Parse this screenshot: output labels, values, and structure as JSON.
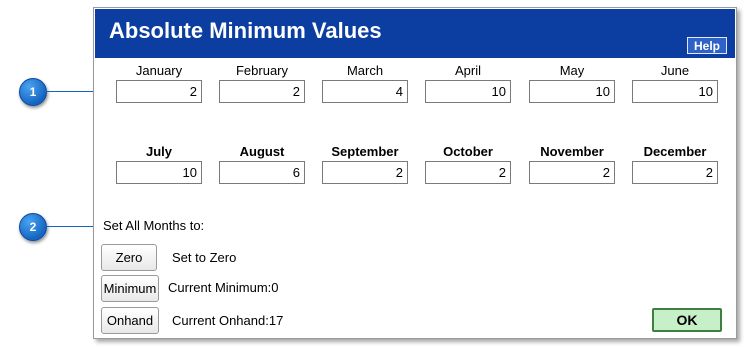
{
  "callouts": [
    "1",
    "2"
  ],
  "dialog": {
    "title": "Absolute Minimum Values",
    "help_label": "Help"
  },
  "months_row1": [
    {
      "label": "January",
      "value": "2"
    },
    {
      "label": "February",
      "value": "2"
    },
    {
      "label": "March",
      "value": "4"
    },
    {
      "label": "April",
      "value": "10"
    },
    {
      "label": "May",
      "value": "10"
    },
    {
      "label": "June",
      "value": "10"
    }
  ],
  "months_row2": [
    {
      "label": "July",
      "value": "10"
    },
    {
      "label": "August",
      "value": "6"
    },
    {
      "label": "September",
      "value": "2"
    },
    {
      "label": "October",
      "value": "2"
    },
    {
      "label": "November",
      "value": "2"
    },
    {
      "label": "December",
      "value": "2"
    }
  ],
  "set_all": {
    "label": "Set All Months to:",
    "zero_label": "Zero",
    "zero_desc": "Set to Zero",
    "minimum_label": "Minimum",
    "minimum_desc": "Current Minimum:0",
    "onhand_label": "Onhand",
    "onhand_desc": "Current Onhand:17"
  },
  "ok_label": "OK"
}
